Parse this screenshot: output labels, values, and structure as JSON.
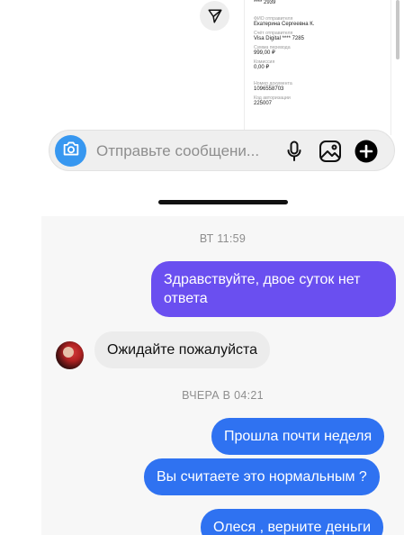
{
  "receipt": {
    "masked_top": "**** 2939",
    "rows": [
      {
        "label": "ФИО отправителя",
        "value": "Екатерина Сергеевна К."
      },
      {
        "label": "Счёт отправителя",
        "value": "Visa Digital **** 7285"
      },
      {
        "label": "Сумма перевода",
        "value": "999,00 ₽"
      },
      {
        "label": "Комиссия",
        "value": "0,00 ₽"
      }
    ],
    "rows2": [
      {
        "label": "Номер документа",
        "value": "1096558703"
      },
      {
        "label": "Код авторизации",
        "value": "225007"
      }
    ]
  },
  "composer": {
    "placeholder": "Отправьте сообщени...",
    "camera_icon": "camera-icon",
    "mic_icon": "microphone-icon",
    "gallery_icon": "gallery-icon",
    "plus_icon": "plus-icon"
  },
  "chat": {
    "timestamp_1": "ВТ 11:59",
    "msg_1": "Здравствуйте, двое суток нет ответа",
    "msg_2": "Ожидайте пожалуйста",
    "timestamp_2": "ВЧЕРА В 04:21",
    "msg_3": "Прошла почти неделя",
    "msg_4": "Вы считаете это нормальным ?",
    "msg_5": "Олеся , верните деньги"
  },
  "colors": {
    "accent_blue": "#3797f0",
    "bubble_purple": "#6a4ff0",
    "bubble_blue": "#2f72f1",
    "incoming_gray": "#ececec"
  }
}
